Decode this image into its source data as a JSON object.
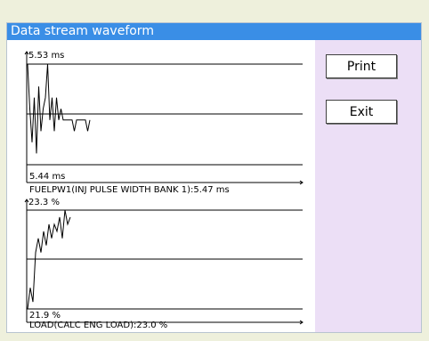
{
  "window": {
    "title": "Data stream waveform"
  },
  "buttons": {
    "print_label": "Print",
    "exit_label": "Exit"
  },
  "charts": [
    {
      "max_label": "5.53 ms",
      "min_label": "5.44 ms",
      "caption": "FUELPW1(INJ PULSE WIDTH BANK 1):5.47 ms"
    },
    {
      "max_label": "23.3 %",
      "min_label": "21.9 %",
      "caption": "LOAD(CALC ENG LOAD):23.0 %"
    }
  ],
  "chart_data": [
    {
      "type": "line",
      "title": "FUELPW1(INJ PULSE WIDTH BANK 1):5.47 ms",
      "ylim": [
        5.44,
        5.53
      ],
      "series": [
        {
          "values": [
            5.53,
            5.49,
            5.46,
            5.5,
            5.45,
            5.51,
            5.47,
            5.49,
            5.5,
            5.53,
            5.48,
            5.5,
            5.47,
            5.5,
            5.48,
            5.49,
            5.48,
            5.48,
            5.48,
            5.48,
            5.48,
            5.47,
            5.48,
            5.48,
            5.48,
            5.48,
            5.48,
            5.47,
            5.48
          ]
        }
      ]
    },
    {
      "type": "line",
      "title": "LOAD(CALC ENG LOAD):23.0 %",
      "ylim": [
        21.9,
        23.3
      ],
      "series": [
        {
          "values": [
            21.9,
            22.2,
            22.0,
            22.7,
            22.9,
            22.7,
            23.0,
            22.8,
            23.1,
            22.9,
            23.1,
            23.0,
            23.2,
            22.9,
            23.3,
            23.1,
            23.2
          ]
        }
      ]
    }
  ]
}
